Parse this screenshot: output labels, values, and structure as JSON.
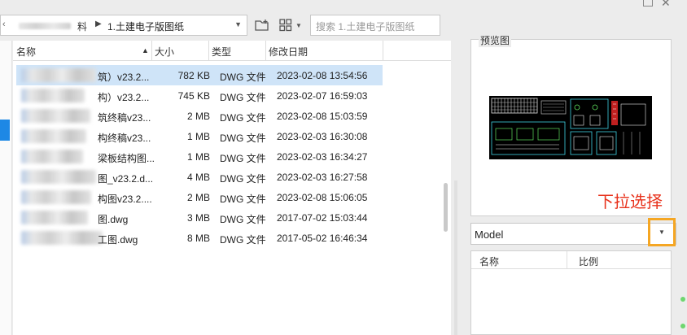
{
  "address": {
    "folder_partial": "料",
    "current": "1.土建电子版图纸"
  },
  "search": {
    "placeholder": "搜索 1.土建电子版图纸"
  },
  "columns": {
    "name": "名称",
    "size": "大小",
    "type": "类型",
    "date": "修改日期"
  },
  "files": [
    {
      "name_tail": "筑）v23.2...",
      "size": "782 KB",
      "type": "DWG 文件",
      "date": "2023-02-08 13:54:56",
      "selected": true
    },
    {
      "name_tail": "构）v23.2...",
      "size": "745 KB",
      "type": "DWG 文件",
      "date": "2023-02-07 16:59:03"
    },
    {
      "name_tail": "筑终稿v23...",
      "size": "2 MB",
      "type": "DWG 文件",
      "date": "2023-02-08 15:03:59"
    },
    {
      "name_tail": "构终稿v23...",
      "size": "1 MB",
      "type": "DWG 文件",
      "date": "2023-02-03 16:30:08"
    },
    {
      "name_tail": "梁板结构图...",
      "size": "1 MB",
      "type": "DWG 文件",
      "date": "2023-02-03 16:34:27"
    },
    {
      "name_tail": "图_v23.2.d...",
      "size": "4 MB",
      "type": "DWG 文件",
      "date": "2023-02-03 16:27:58"
    },
    {
      "name_tail": "构图v23.2....",
      "size": "2 MB",
      "type": "DWG 文件",
      "date": "2023-02-08 15:06:05"
    },
    {
      "name_tail": "图.dwg",
      "size": "3 MB",
      "type": "DWG 文件",
      "date": "2017-07-02 15:03:44"
    },
    {
      "name_tail": "工图.dwg",
      "size": "8 MB",
      "type": "DWG 文件",
      "date": "2017-05-02 16:46:34"
    }
  ],
  "preview": {
    "label": "预览图"
  },
  "annotation": {
    "text": "下拉选择",
    "color": "#e8321c"
  },
  "layout_select": {
    "value": "Model"
  },
  "layout_table": {
    "col_name": "名称",
    "col_scale": "比例"
  },
  "colors": {
    "selection": "#cfe4f8",
    "highlight_box": "#f5a623",
    "accent": "#1e88e5"
  }
}
